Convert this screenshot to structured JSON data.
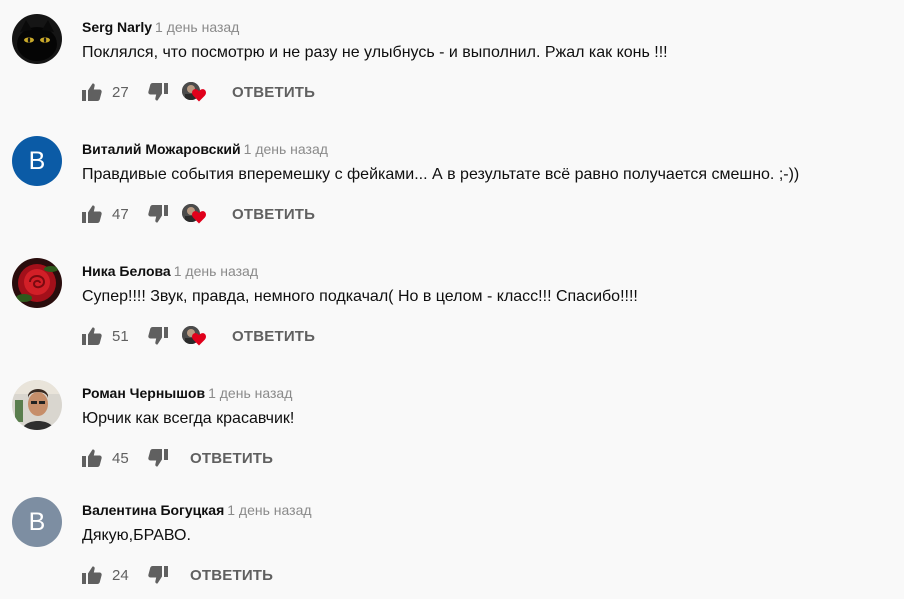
{
  "colors": {
    "background": "#f9f9f9",
    "time": "#8a8a8a",
    "icon": "#606060",
    "heart": "#e0001b",
    "avatar_blue": "#0b5ba6",
    "avatar_gray": "#7d8ea2"
  },
  "icons": {
    "like": "thumb-up-icon",
    "dislike": "thumb-down-icon",
    "creator_heart": "creator-heart-icon"
  },
  "comments": [
    {
      "author": "Serg Narly",
      "time": "1 день назад",
      "text": "Поклялся, что посмотрю и не разу не улыбнусь - и выполнил. Ржал как конь !!!",
      "likes": "27",
      "reply": "ОТВЕТИТЬ",
      "hearted": true,
      "avatar": "cat-photo-avatar"
    },
    {
      "author": "Виталий Можаровский",
      "time": "1 день назад",
      "text": "Правдивые события вперемешку с фейками... А в результате всё равно получается смешно. ;-))",
      "likes": "47",
      "reply": "ОТВЕТИТЬ",
      "hearted": true,
      "avatar_letter": "В"
    },
    {
      "author": "Ника Белова",
      "time": "1 день назад",
      "text": "Супер!!!! Звук, правда, немного подкачал( Но в целом - класс!!! Спасибо!!!!",
      "likes": "51",
      "reply": "ОТВЕТИТЬ",
      "hearted": true,
      "avatar": "rose-photo-avatar"
    },
    {
      "author": "Роман Чернышов",
      "time": "1 день назад",
      "text": "Юрчик как всегда красавчик!",
      "likes": "45",
      "reply": "ОТВЕТИТЬ",
      "hearted": false,
      "avatar": "person-photo-avatar"
    },
    {
      "author": "Валентина Богуцкая",
      "time": "1 день назад",
      "text": "Дякую,БРАВО.",
      "likes": "24",
      "reply": "ОТВЕТИТЬ",
      "hearted": false,
      "avatar_letter": "В"
    }
  ]
}
